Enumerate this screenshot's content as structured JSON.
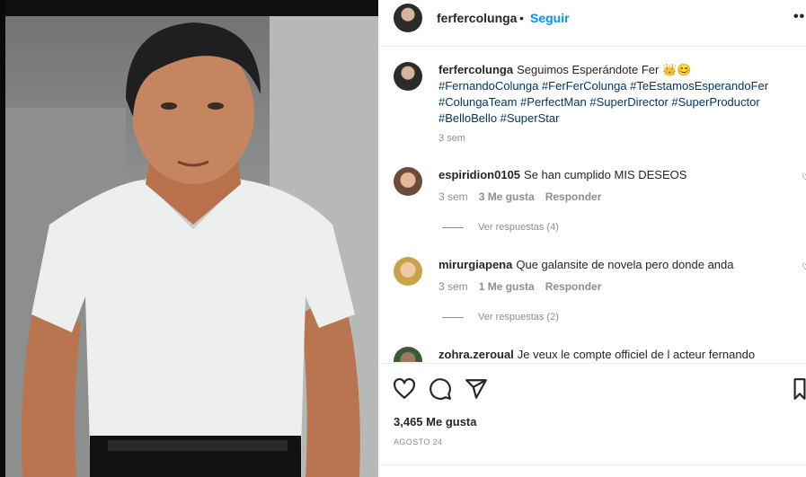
{
  "post": {
    "username": "ferfercolunga",
    "follow_separator": "•",
    "follow_label": "Seguir",
    "more_label": "••"
  },
  "caption": {
    "username": "ferfercolunga",
    "text": "Seguimos Esperándote Fer 👑😊",
    "hashtags_line1": "#FernandoColunga #FerFerColunga #TeEstamosEsperandoFer",
    "hashtags_line2": "#ColungaTeam #PerfectMan #SuperDirector #SuperProductor",
    "hashtags_line3": "#BelloBello #SuperStar",
    "time": "3 sem"
  },
  "comments": [
    {
      "username": "espiridion0105",
      "text": "Se han cumplido MIS DESEOS",
      "time": "3 sem",
      "likes": "3 Me gusta",
      "reply_label": "Responder",
      "view_replies": "Ver respuestas (4)"
    },
    {
      "username": "mirurgiapena",
      "text": "Que galansite de novela pero donde anda",
      "time": "3 sem",
      "likes": "1 Me gusta",
      "reply_label": "Responder",
      "view_replies": "Ver respuestas (2)"
    },
    {
      "username": "zohra.zeroual",
      "text": "Je veux le compte officiel de l acteur fernando"
    }
  ],
  "footer": {
    "likes": "3,465 Me gusta",
    "date": "AGOSTO 24"
  },
  "icons": {
    "like": "heart-icon",
    "comment": "comment-icon",
    "share": "share-icon",
    "save": "bookmark-icon"
  },
  "colors": {
    "link": "#0095f6",
    "hashtag": "#00376b",
    "muted": "#8e8e8e"
  }
}
